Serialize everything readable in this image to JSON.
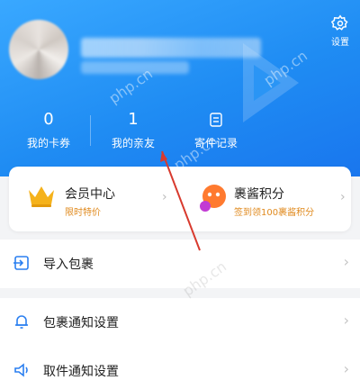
{
  "profile": {
    "settings_label": "设置"
  },
  "stats": [
    {
      "value": "0",
      "label": "我的卡券"
    },
    {
      "value": "1",
      "label": "我的亲友"
    },
    {
      "value": "",
      "label": "寄件记录"
    }
  ],
  "cards": {
    "member": {
      "title": "会员中心",
      "subtitle": "限时特价"
    },
    "points": {
      "title": "裹酱积分",
      "subtitle": "签到领100裹酱积分"
    }
  },
  "menu": [
    {
      "label": "导入包裹"
    },
    {
      "label": "包裹通知设置"
    },
    {
      "label": "取件通知设置"
    }
  ],
  "watermark": "php.cn",
  "colors": {
    "header": "#1f8cf3",
    "accent": "#e08a1e"
  }
}
